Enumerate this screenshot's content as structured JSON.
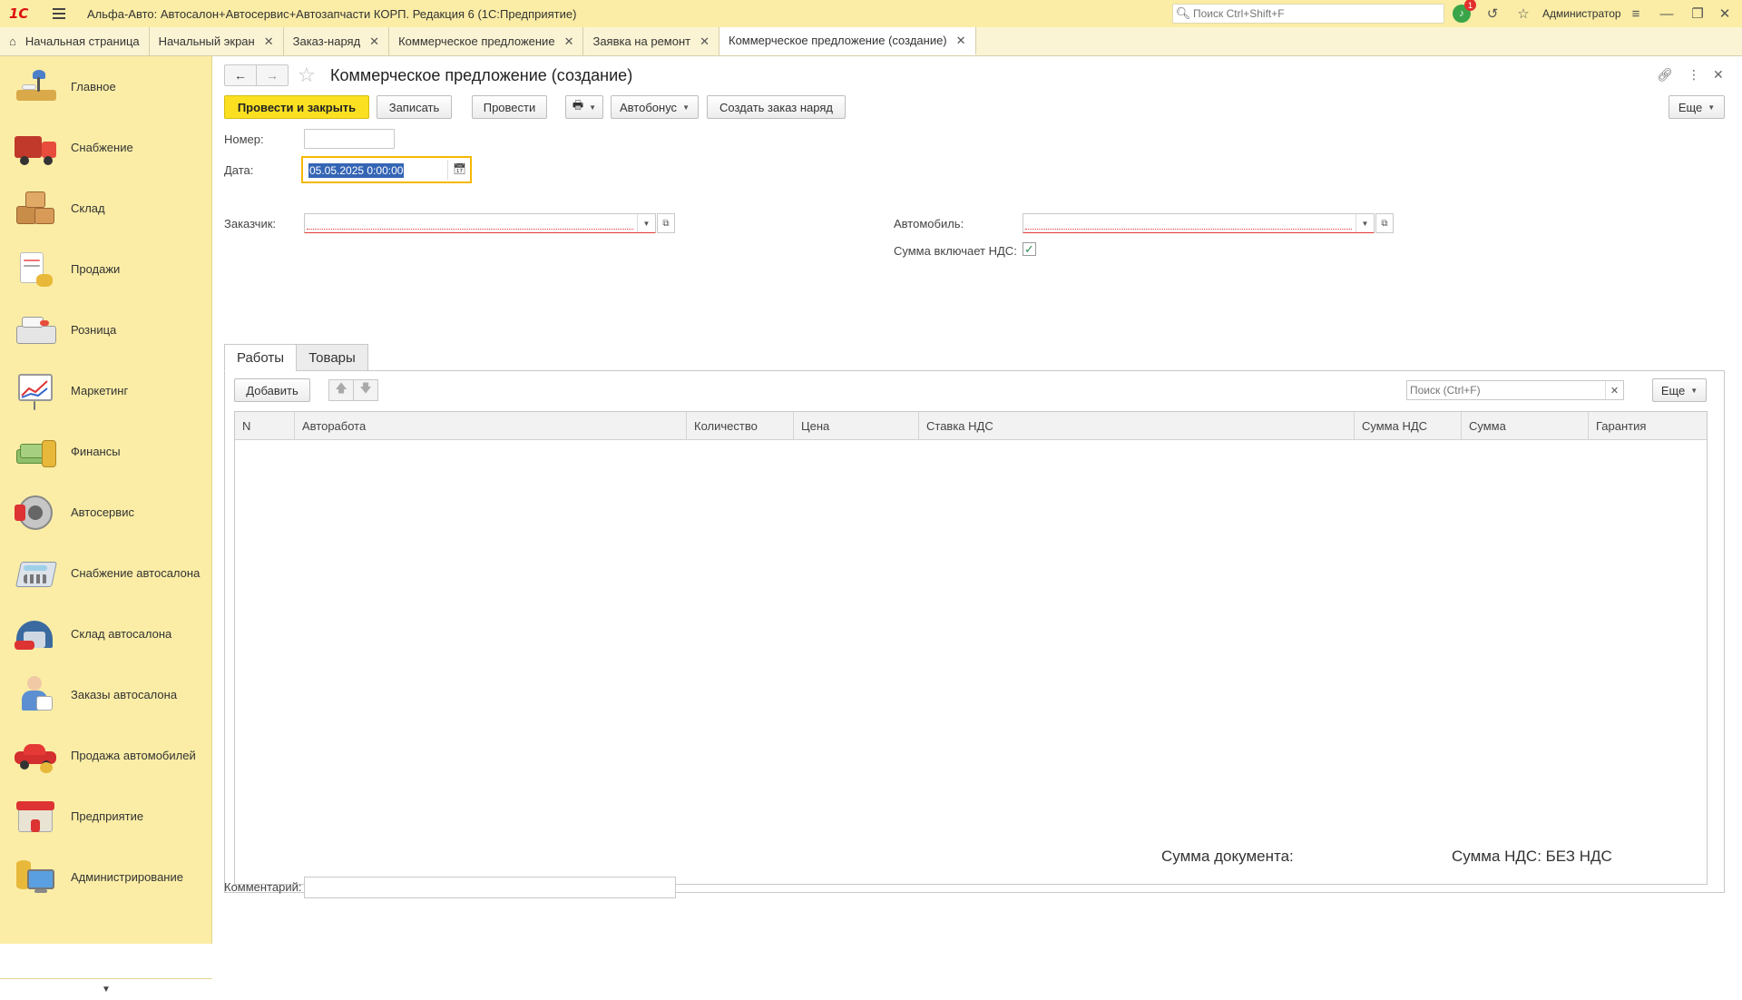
{
  "titlebar": {
    "logo": "1С",
    "app_title": "Альфа-Авто: Автосалон+Автосервис+Автозапчасти КОРП. Редакция 6  (1С:Предприятие)",
    "search_placeholder": "Поиск Ctrl+Shift+F",
    "notification_count": "1",
    "user": "Администратор"
  },
  "window_tabs": [
    {
      "label": "Начальная страница"
    },
    {
      "label": "Начальный экран"
    },
    {
      "label": "Заказ-наряд"
    },
    {
      "label": "Коммерческое предложение"
    },
    {
      "label": "Заявка на ремонт"
    },
    {
      "label": "Коммерческое предложение (создание)",
      "active": true
    }
  ],
  "sidebar": {
    "items": [
      {
        "label": "Главное",
        "icon": "desk-lamp-icon"
      },
      {
        "label": "Снабжение",
        "icon": "truck-icon"
      },
      {
        "label": "Склад",
        "icon": "boxes-icon"
      },
      {
        "label": "Продажи",
        "icon": "invoice-coins-icon"
      },
      {
        "label": "Розница",
        "icon": "cash-register-icon"
      },
      {
        "label": "Маркетинг",
        "icon": "chart-board-icon"
      },
      {
        "label": "Финансы",
        "icon": "money-stack-icon"
      },
      {
        "label": "Автосервис",
        "icon": "brake-disc-icon"
      },
      {
        "label": "Снабжение автосалона",
        "icon": "calculator-icon"
      },
      {
        "label": "Склад автосалона",
        "icon": "garage-icon"
      },
      {
        "label": "Заказы автосалона",
        "icon": "manager-icon"
      },
      {
        "label": "Продажа автомобилей",
        "icon": "red-car-icon"
      },
      {
        "label": "Предприятие",
        "icon": "building-icon"
      },
      {
        "label": "Администрирование",
        "icon": "computer-db-icon"
      }
    ]
  },
  "document": {
    "title": "Коммерческое предложение (создание)",
    "toolbar": {
      "post_and_close": "Провести и закрыть",
      "save": "Записать",
      "post": "Провести",
      "autobonus": "Автобонус",
      "create_order": "Создать заказ наряд",
      "more": "Еще"
    },
    "fields": {
      "number_label": "Номер:",
      "number_value": "",
      "date_label": "Дата:",
      "date_value": "05.05.2025  0:00:00",
      "customer_label": "Заказчик:",
      "customer_value": "",
      "car_label": "Автомобиль:",
      "car_value": "",
      "vat_included_label": "Сумма включает НДС:",
      "vat_included": true
    },
    "section_tabs": [
      {
        "label": "Работы",
        "active": true
      },
      {
        "label": "Товары"
      }
    ],
    "table_toolbar": {
      "add": "Добавить",
      "search_placeholder": "Поиск (Ctrl+F)",
      "more": "Еще"
    },
    "table": {
      "columns": [
        "N",
        "Авторабота",
        "Количество",
        "Цена",
        "Ставка НДС",
        "Сумма НДС",
        "Сумма",
        "Гарантия"
      ],
      "rows": []
    },
    "totals": {
      "doc_sum": "Сумма документа:",
      "vat_sum": "Сумма НДС: БЕЗ НДС"
    },
    "comment_label": "Комментарий:",
    "comment_value": ""
  },
  "colors": {
    "panel_yellow": "#fbeda6",
    "primary_button": "#fbe022",
    "focus_border": "#f5b800",
    "required_red": "#e53935"
  }
}
